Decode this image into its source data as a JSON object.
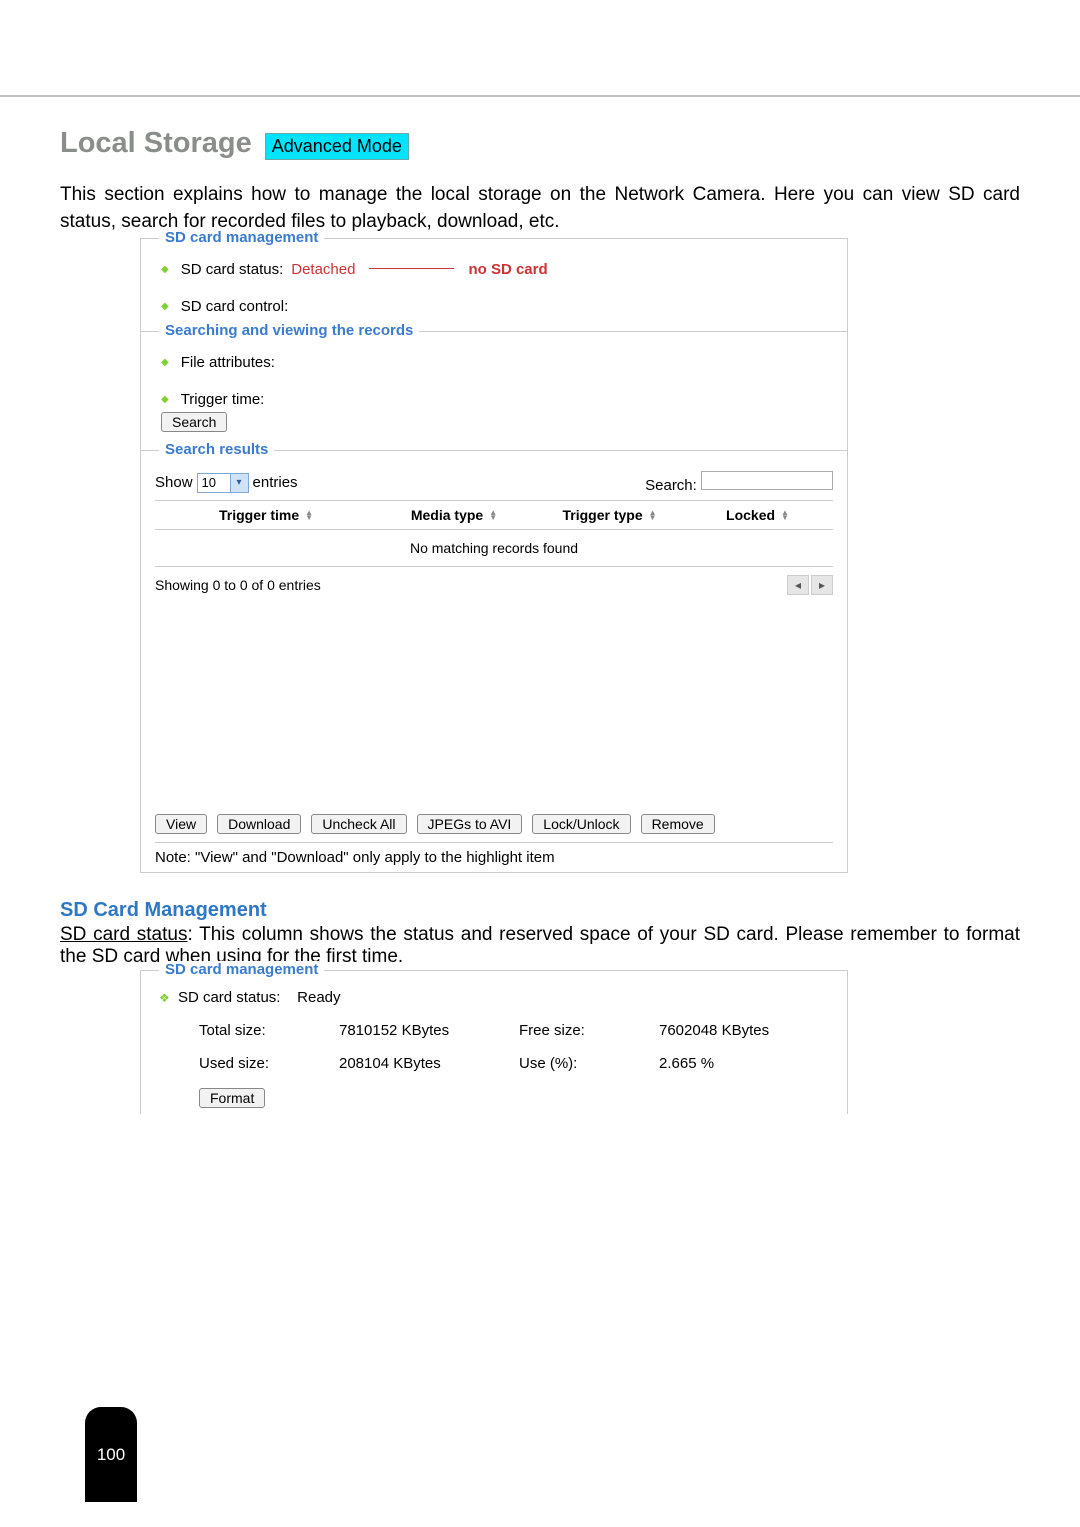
{
  "page_number": "100",
  "header": {
    "title": "Local Storage",
    "mode_label": "Advanced Mode"
  },
  "intro_text": "This section explains how to manage the local storage on the Network Camera. Here you can view SD card status, search for recorded files to playback, download, etc.",
  "panel1": {
    "legend": "SD card management",
    "status_label": "SD card status:",
    "status_value": "Detached",
    "status_annotation": "no SD card",
    "control_label": "SD card control:"
  },
  "panel2": {
    "legend": "Searching and viewing the records",
    "file_attr_label": "File attributes:",
    "trigger_time_label": "Trigger time:",
    "search_btn": "Search"
  },
  "panel3": {
    "legend": "Search results",
    "show_label": "Show",
    "show_value": "10",
    "entries_label": "entries",
    "search_label": "Search:",
    "columns": {
      "c1": "Trigger time",
      "c2": "Media type",
      "c3": "Trigger type",
      "c4": "Locked"
    },
    "no_match": "No matching records found",
    "showing_text": "Showing 0 to 0 of 0 entries"
  },
  "actions": {
    "view": "View",
    "download": "Download",
    "uncheck": "Uncheck All",
    "jpegs": "JPEGs to AVI",
    "lock": "Lock/Unlock",
    "remove": "Remove"
  },
  "note_text": "Note: \"View\" and \"Download\" only apply to the highlight item",
  "sd_mgmt_heading": "SD Card Management",
  "sd_para_label": "SD card status",
  "sd_para_text": ": This column shows the status and reserved space of your SD card. Please remember to format the SD card when using for the first time.",
  "panel4": {
    "legend": "SD card management",
    "status_label": "SD card status:",
    "status_value": "Ready",
    "total_size_label": "Total size:",
    "total_size_value": "7810152 KBytes",
    "free_size_label": "Free size:",
    "free_size_value": "7602048 KBytes",
    "used_size_label": "Used size:",
    "used_size_value": "208104 KBytes",
    "use_pct_label": "Use (%):",
    "use_pct_value": "2.665 %",
    "format_btn": "Format"
  }
}
